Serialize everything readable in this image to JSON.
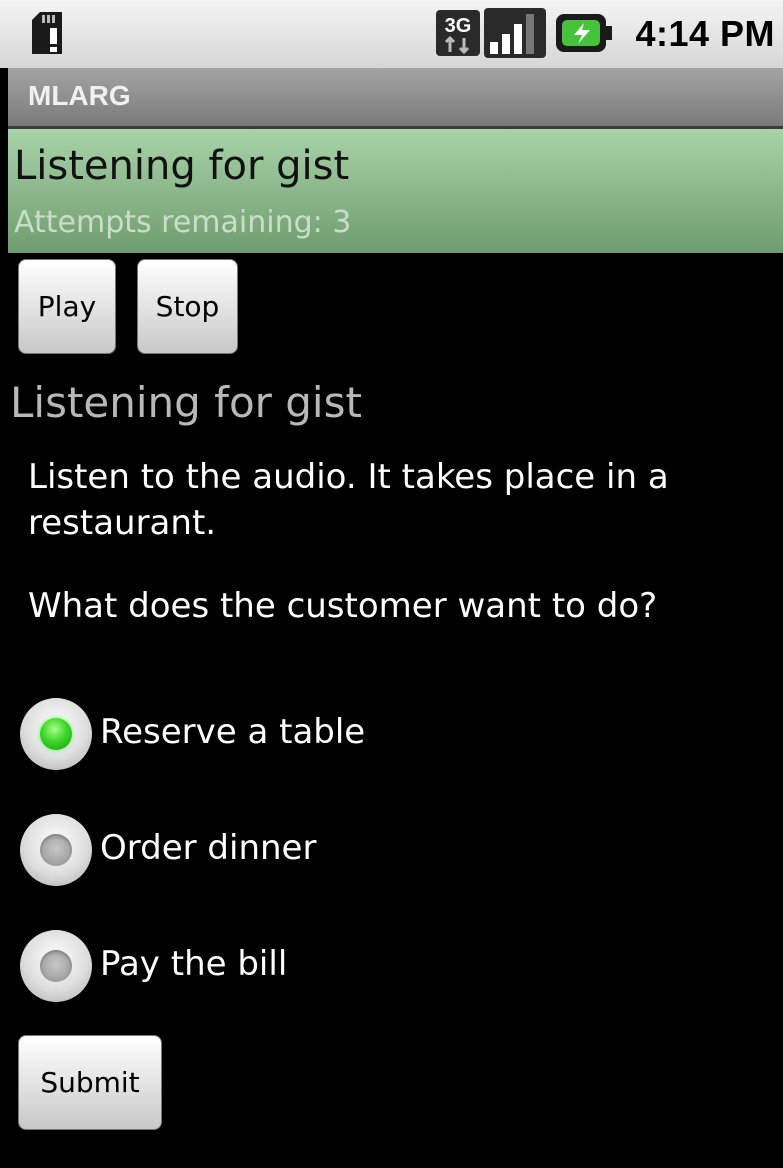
{
  "status_bar": {
    "time": "4:14 PM",
    "icons": [
      "sd-card-warning-icon",
      "3g-data-icon",
      "signal-strength-icon",
      "battery-charging-icon"
    ]
  },
  "app": {
    "title": "MLARG"
  },
  "header": {
    "title": "Listening for gist",
    "attempts_text": "Attempts remaining: 3"
  },
  "controls": {
    "play_label": "Play",
    "stop_label": "Stop"
  },
  "content": {
    "section_title": "Listening for gist",
    "instruction": "Listen to the audio. It takes place in a restaurant.",
    "question": "What does the customer want to do?"
  },
  "options": [
    {
      "label": "Reserve a table",
      "selected": true
    },
    {
      "label": "Order dinner",
      "selected": false
    },
    {
      "label": "Pay the bill",
      "selected": false
    }
  ],
  "submit_label": "Submit",
  "colors": {
    "header_green": "#8fbf8f",
    "radio_selected": "#3ed62a",
    "background": "#000000"
  }
}
